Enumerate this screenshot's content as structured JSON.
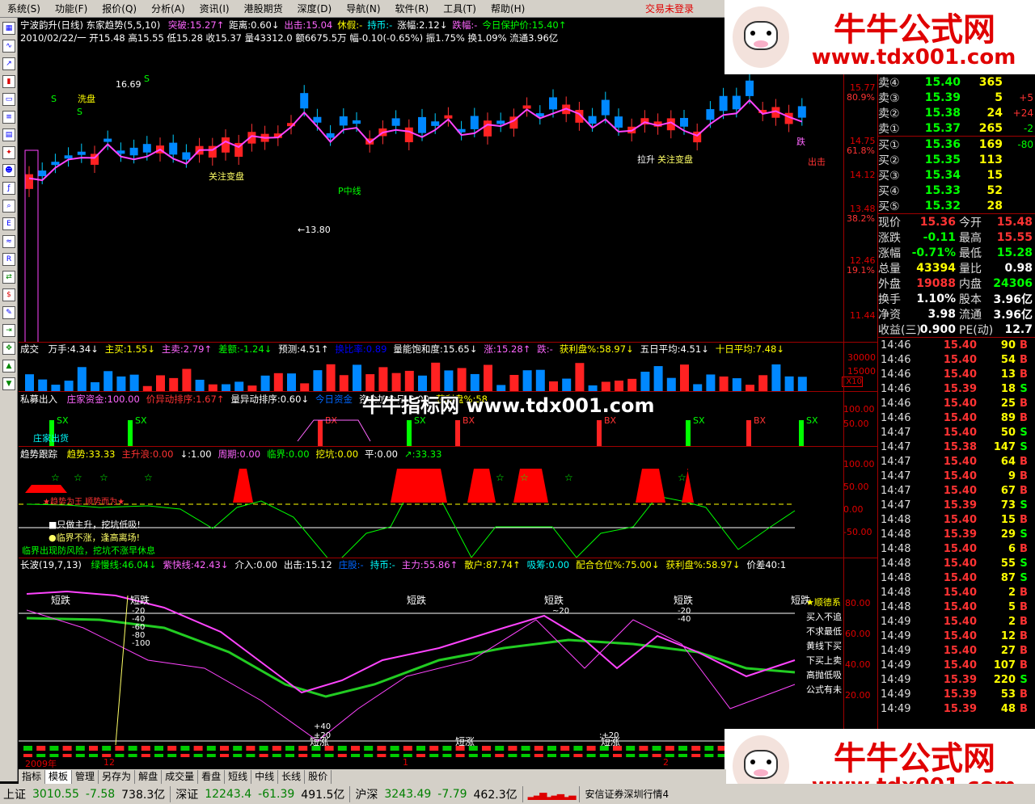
{
  "menu": {
    "items": [
      "系统(S)",
      "功能(F)",
      "报价(Q)",
      "分析(A)",
      "资讯(I)",
      "港股期货",
      "深度(D)",
      "导航(N)",
      "软件(R)",
      "工具(T)",
      "帮助(H)"
    ],
    "login_status": "交易未登录"
  },
  "stock": {
    "header": "宁波韵升(日线) 东家趋势(5,5,10)",
    "indicators": [
      {
        "text": "突破:15.27↑",
        "color": "#ff66ff"
      },
      {
        "text": "距离:0.60↓",
        "color": "#ffffff"
      },
      {
        "text": "出击:15.04",
        "color": "#ff66ff"
      },
      {
        "text": "休假:-",
        "color": "#ffff00"
      },
      {
        "text": "持币:-",
        "color": "#00ffff"
      },
      {
        "text": "涨幅:2.12↓",
        "color": "#ffffff"
      },
      {
        "text": "跌幅:-",
        "color": "#ff66ff"
      },
      {
        "text": "今日保护价:15.40↑",
        "color": "#00ff00"
      }
    ],
    "ohlc_line": "2010/02/22/一 开15.48 高15.55 低15.28 收15.37 量43312.0 额6675.5万 幅-0.10(-0.65%) 振1.75% 换1.09% 流通3.96亿",
    "price_labels": [
      "15.77",
      "80.9%",
      "14.75",
      "61.8%",
      "14.12",
      "13.48",
      "38.2%",
      "12.46",
      "19.1%",
      "11.44"
    ],
    "annotations": [
      "16.69",
      "←13.80",
      "洗盘",
      "关注变盘",
      "P中线",
      "拉升",
      "关注变盘",
      "出击",
      "S",
      "S",
      "S",
      "跌"
    ]
  },
  "volume_panel": {
    "title": "成交",
    "items": [
      "万手:4.34↓",
      "主买:1.55↓",
      "主卖:2.79↑",
      "差额:-1.24↓",
      "预测:4.51↑",
      "换比率:0.89",
      "量能饱和度:15.65↓",
      "涨:15.28↑",
      "跌:-",
      "获利盘%:58.97↓",
      "五日平均:4.51↓",
      "十日平均:7.48↓"
    ],
    "axis": [
      "30000",
      "15000",
      "X10"
    ]
  },
  "private_panel": {
    "title": "私募出入",
    "items": [
      "庄家资金:100.00",
      "价异动排序:1.67↑",
      "量异动排序:0.60↓",
      "今日资金",
      "资金加仓日:0.00",
      "获利盘%:58"
    ],
    "axis": [
      "100.00",
      "50.00"
    ],
    "marks": [
      "SX",
      "SX",
      "BX",
      "SX",
      "BX",
      "BX",
      "SX",
      "BX",
      "SX"
    ],
    "label": "庄家出货"
  },
  "trend_panel": {
    "title": "趋势跟踪",
    "items": [
      "趋势:33.33",
      "主升浪:0.00",
      "↓:1.00",
      "周期:0.00",
      "临界:0.00",
      "挖坑:0.00",
      "平:0.00",
      "↗:33.33"
    ],
    "axis": [
      "100.00",
      "50.00",
      "0.00",
      "-50.00"
    ],
    "notes": [
      "■只做主升，挖坑低吸!",
      "●临界不涨，逢高离场!",
      "临界出现防风险，挖坑不涨早休息"
    ],
    "warning": "★趋势为王 顺势而为★"
  },
  "wave_panel": {
    "title": "长波(19,7,13)",
    "items": [
      "绿慢线:46.04↓",
      "紫快线:42.43↓",
      "介入:0.00",
      "出击:15.12",
      "庄股:-",
      "持币:-",
      "主力:55.86↑",
      "散户:87.74↑",
      "吸筹:0.00",
      "配合仓位%:75.00↓",
      "获利盘%:58.97↓",
      "价差40:1"
    ],
    "axis": [
      "80.00",
      "60.00",
      "40.00",
      "20.00"
    ],
    "legend": [
      "★顺德系",
      "买入不追",
      "不求最低",
      "黄线下买",
      "下买上卖",
      "高抛低吸",
      "公式有未"
    ],
    "marks": [
      "短跌",
      "短跌",
      "短跌",
      "短跌",
      "短跌",
      "短跌",
      "短涨",
      "短涨",
      "短涨",
      "短涨"
    ],
    "levels": [
      "-20",
      "-40",
      "-60",
      "-80",
      "-100",
      "~20",
      "-20",
      "-40",
      "+40",
      "+20",
      ":+20",
      ":+20"
    ]
  },
  "date_axis": [
    "2009年",
    "12",
    "1",
    "2"
  ],
  "tabs": [
    "指标",
    "模板",
    "管理",
    "另存为",
    "解盘",
    "成交量",
    "看盘",
    "短线",
    "中线",
    "长线",
    "股价"
  ],
  "quote": {
    "asks": [
      {
        "label": "卖④",
        "price": "15.40",
        "vol": "365",
        "chg": ""
      },
      {
        "label": "卖③",
        "price": "15.39",
        "vol": "5",
        "chg": "+5"
      },
      {
        "label": "卖②",
        "price": "15.38",
        "vol": "24",
        "chg": "+24"
      },
      {
        "label": "卖①",
        "price": "15.37",
        "vol": "265",
        "chg": "-2"
      }
    ],
    "bids": [
      {
        "label": "买①",
        "price": "15.36",
        "vol": "169",
        "chg": "-80"
      },
      {
        "label": "买②",
        "price": "15.35",
        "vol": "113",
        "chg": ""
      },
      {
        "label": "买③",
        "price": "15.34",
        "vol": "15",
        "chg": ""
      },
      {
        "label": "买④",
        "price": "15.33",
        "vol": "52",
        "chg": ""
      },
      {
        "label": "买⑤",
        "price": "15.32",
        "vol": "28",
        "chg": ""
      }
    ],
    "stats": [
      {
        "l1": "现价",
        "v1": "15.36",
        "c1": "#ff3333",
        "l2": "今开",
        "v2": "15.48",
        "c2": "#ff3333"
      },
      {
        "l1": "涨跌",
        "v1": "-0.11",
        "c1": "#00ff00",
        "l2": "最高",
        "v2": "15.55",
        "c2": "#ff3333"
      },
      {
        "l1": "涨幅",
        "v1": "-0.71%",
        "c1": "#00ff00",
        "l2": "最低",
        "v2": "15.28",
        "c2": "#00ff00"
      },
      {
        "l1": "总量",
        "v1": "43394",
        "c1": "#ffff00",
        "l2": "量比",
        "v2": "0.98",
        "c2": "#ffffff"
      },
      {
        "l1": "外盘",
        "v1": "19088",
        "c1": "#ff3333",
        "l2": "内盘",
        "v2": "24306",
        "c2": "#00ff00"
      },
      {
        "l1": "换手",
        "v1": "1.10%",
        "c1": "#ffffff",
        "l2": "股本",
        "v2": "3.96亿",
        "c2": "#ffffff"
      },
      {
        "l1": "净资",
        "v1": "3.98",
        "c1": "#ffffff",
        "l2": "流通",
        "v2": "3.96亿",
        "c2": "#ffffff"
      },
      {
        "l1": "收益(三)",
        "v1": "0.900",
        "c1": "#ffffff",
        "l2": "PE(动)",
        "v2": "12.7",
        "c2": "#ffffff"
      }
    ],
    "ticks": [
      {
        "t": "14:46",
        "p": "15.40",
        "v": "90",
        "bs": "B"
      },
      {
        "t": "14:46",
        "p": "15.40",
        "v": "54",
        "bs": "B"
      },
      {
        "t": "14:46",
        "p": "15.40",
        "v": "13",
        "bs": "B"
      },
      {
        "t": "14:46",
        "p": "15.39",
        "v": "18",
        "bs": "S"
      },
      {
        "t": "14:46",
        "p": "15.40",
        "v": "25",
        "bs": "B"
      },
      {
        "t": "14:46",
        "p": "15.40",
        "v": "89",
        "bs": "B"
      },
      {
        "t": "14:47",
        "p": "15.40",
        "v": "50",
        "bs": "S"
      },
      {
        "t": "14:47",
        "p": "15.38",
        "v": "147",
        "bs": "S"
      },
      {
        "t": "14:47",
        "p": "15.40",
        "v": "64",
        "bs": "B"
      },
      {
        "t": "14:47",
        "p": "15.40",
        "v": "9",
        "bs": "B"
      },
      {
        "t": "14:47",
        "p": "15.40",
        "v": "67",
        "bs": "B"
      },
      {
        "t": "14:47",
        "p": "15.39",
        "v": "73",
        "bs": "S"
      },
      {
        "t": "14:48",
        "p": "15.40",
        "v": "15",
        "bs": "B"
      },
      {
        "t": "14:48",
        "p": "15.39",
        "v": "29",
        "bs": "S"
      },
      {
        "t": "14:48",
        "p": "15.40",
        "v": "6",
        "bs": "B"
      },
      {
        "t": "14:48",
        "p": "15.40",
        "v": "55",
        "bs": "S"
      },
      {
        "t": "14:48",
        "p": "15.40",
        "v": "87",
        "bs": "S"
      },
      {
        "t": "14:48",
        "p": "15.40",
        "v": "2",
        "bs": "B"
      },
      {
        "t": "14:48",
        "p": "15.40",
        "v": "5",
        "bs": "B"
      },
      {
        "t": "14:49",
        "p": "15.40",
        "v": "2",
        "bs": "B"
      },
      {
        "t": "14:49",
        "p": "15.40",
        "v": "12",
        "bs": "B"
      },
      {
        "t": "14:49",
        "p": "15.40",
        "v": "27",
        "bs": "B"
      },
      {
        "t": "14:49",
        "p": "15.40",
        "v": "107",
        "bs": "B"
      },
      {
        "t": "14:49",
        "p": "15.39",
        "v": "220",
        "bs": "S"
      },
      {
        "t": "14:49",
        "p": "15.39",
        "v": "53",
        "bs": "B"
      },
      {
        "t": "14:49",
        "p": "15.39",
        "v": "48",
        "bs": "B"
      }
    ]
  },
  "ads": {
    "brand": "牛牛公式网",
    "url": "www.tdx001.com",
    "watermark": "牛牛指标网 www.tdx001.com"
  },
  "status": {
    "indices": [
      {
        "name": "上证",
        "value": "3010.55",
        "chg": "-7.58",
        "amt": "738.3亿"
      },
      {
        "name": "深证",
        "value": "12243.4",
        "chg": "-61.39",
        "amt": "491.5亿"
      },
      {
        "name": "沪深",
        "value": "3243.49",
        "chg": "-7.79",
        "amt": "462.3亿"
      }
    ],
    "broker": "安信证券深圳行情4"
  },
  "colors": {
    "up": "#ff3333",
    "down": "#00ff00",
    "border": "#a00000",
    "accent_yellow": "#ffff00"
  }
}
